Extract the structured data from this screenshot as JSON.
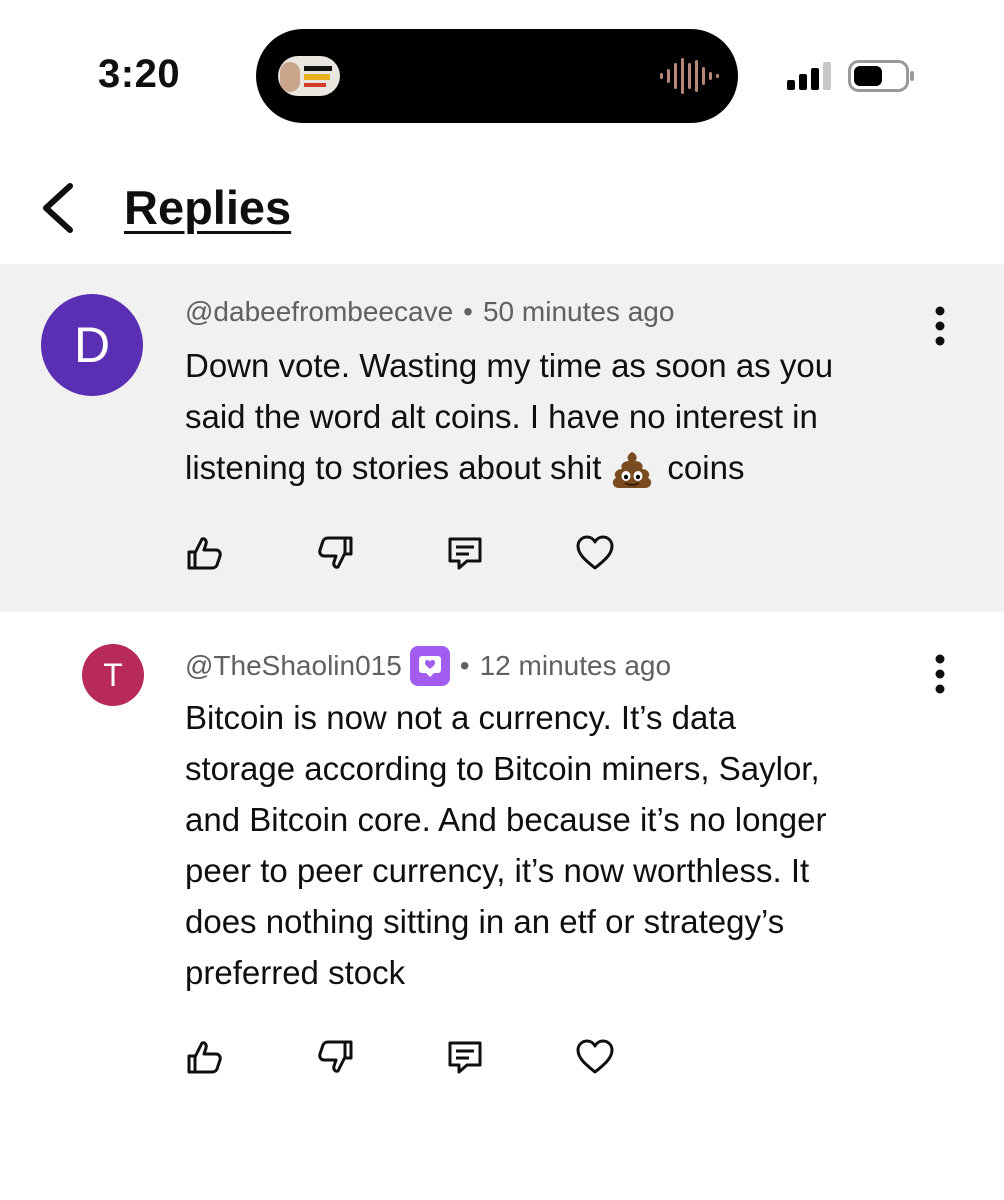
{
  "status_bar": {
    "time": "3:20",
    "now_playing_icon": "audio-waveform-icon",
    "signal_icon": "cellular-signal-icon",
    "battery_icon": "battery-low-power-icon"
  },
  "header": {
    "title": "Replies",
    "back_icon": "chevron-left-icon"
  },
  "colors": {
    "highlight_bg": "#f1f1f1",
    "avatar_d": "#5b2fb3",
    "avatar_t": "#b72a5b",
    "member_badge": "#a35cf0",
    "meta_text": "#606060"
  },
  "comments": [
    {
      "avatar_letter": "D",
      "author": "@dabeefrombeecave",
      "separator": "•",
      "time": "50 minutes ago",
      "lines": [
        "Down vote.  Wasting my time as soon as you",
        "said the word alt coins.  I have no interest in",
        "listening to stories about shit"
      ],
      "line3_tail": "coins",
      "emoji": "pile-of-poo-emoji",
      "actions": [
        "thumbs-up-icon",
        "thumbs-down-icon",
        "reply-icon",
        "heart-icon"
      ]
    },
    {
      "avatar_letter": "T",
      "author": "@TheShaolin015",
      "badge": "member-badge-icon",
      "separator": "•",
      "time": "12 minutes ago",
      "lines": [
        "Bitcoin is now not a currency. It’s data",
        "storage according to Bitcoin miners, Saylor,",
        "and Bitcoin core. And because it’s no longer",
        "peer to peer currency, it’s now worthless. It",
        "does nothing sitting in an etf or strategy’s",
        "preferred stock"
      ],
      "actions": [
        "thumbs-up-icon",
        "thumbs-down-icon",
        "reply-icon",
        "heart-icon"
      ]
    }
  ]
}
